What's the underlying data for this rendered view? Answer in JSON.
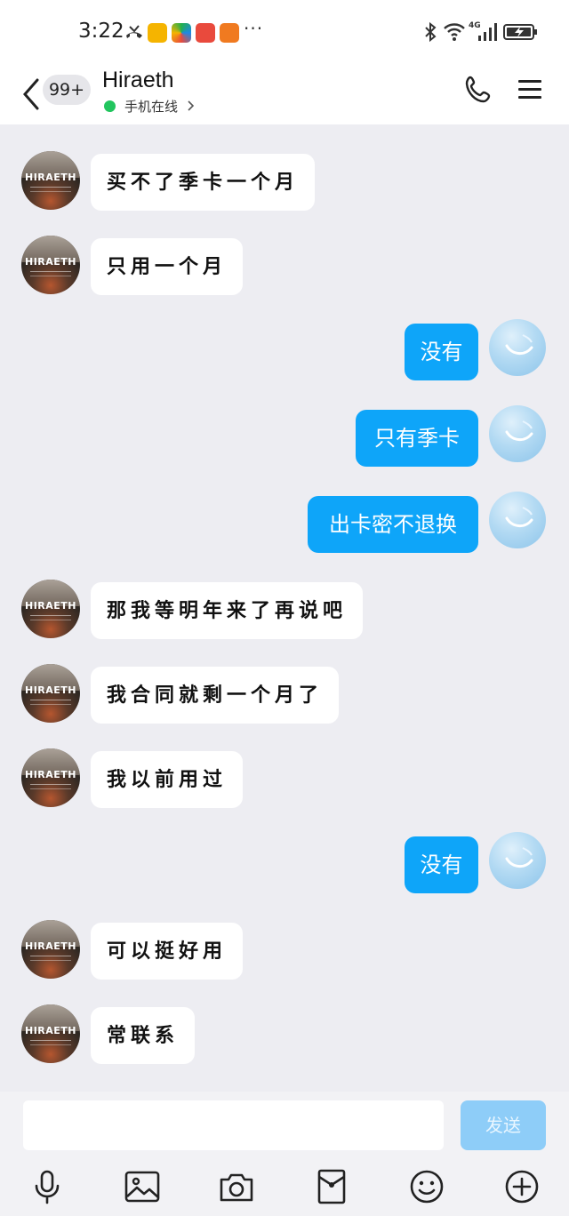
{
  "status_bar": {
    "time": "3:22",
    "more": "···",
    "network": "4G",
    "badge_colors": [
      "#f5b400",
      "#22b04b",
      "#e94a3d",
      "#f07a20"
    ]
  },
  "header": {
    "back_icon": "chevron-left-icon",
    "unread_count": "99+",
    "contact_name": "Hiraeth",
    "online_status": "手机在线",
    "online_color": "#22c55e",
    "call_icon": "phone-icon",
    "menu_icon": "hamburger-menu-icon"
  },
  "avatars": {
    "contact_avatar_text": "HIRAETH"
  },
  "messages": [
    {
      "side": "left",
      "text": "买不了季卡一个月"
    },
    {
      "side": "left",
      "text": "只用一个月"
    },
    {
      "side": "right",
      "text": "没有"
    },
    {
      "side": "right",
      "text": "只有季卡"
    },
    {
      "side": "right",
      "text": "出卡密不退换"
    },
    {
      "side": "left",
      "text": "那我等明年来了再说吧"
    },
    {
      "side": "left",
      "text": "我合同就剩一个月了"
    },
    {
      "side": "left",
      "text": "我以前用过"
    },
    {
      "side": "right",
      "text": "没有"
    },
    {
      "side": "left",
      "text": "可以挺好用"
    },
    {
      "side": "left",
      "text": "常联系"
    }
  ],
  "colors": {
    "accent": "#0ea5f9",
    "send_disabled": "#8ecdf8",
    "chat_background": "#ededf2"
  },
  "input": {
    "value": "",
    "placeholder": "",
    "send_label": "发送"
  },
  "toolbar": [
    {
      "icon": "microphone-icon"
    },
    {
      "icon": "image-icon"
    },
    {
      "icon": "camera-icon"
    },
    {
      "icon": "red-packet-icon"
    },
    {
      "icon": "emoji-icon"
    },
    {
      "icon": "plus-circle-icon"
    }
  ]
}
